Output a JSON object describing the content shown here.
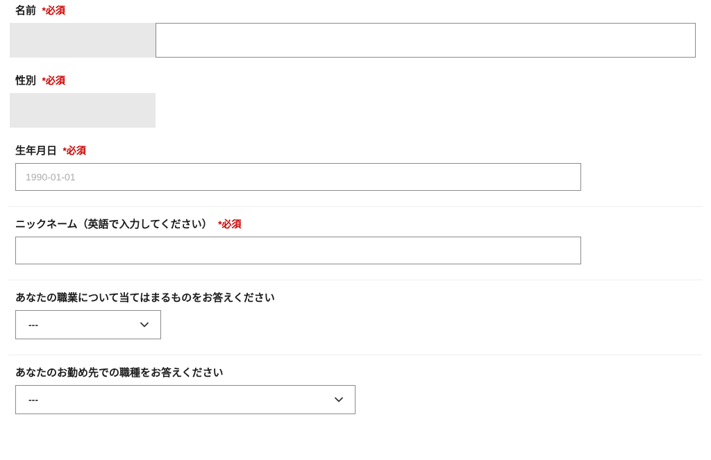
{
  "required_marker": "*必須",
  "fields": {
    "name": {
      "label": "名前"
    },
    "gender": {
      "label": "性別"
    },
    "birthdate": {
      "label": "生年月日",
      "placeholder": "1990-01-01"
    },
    "nickname": {
      "label": "ニックネーム（英語で入力してください）"
    },
    "occupation": {
      "label": "あなたの職業について当てはまるものをお答えください",
      "selected": "---"
    },
    "jobtype": {
      "label": "あなたのお勤め先での職種をお答えください",
      "selected": "---"
    }
  }
}
